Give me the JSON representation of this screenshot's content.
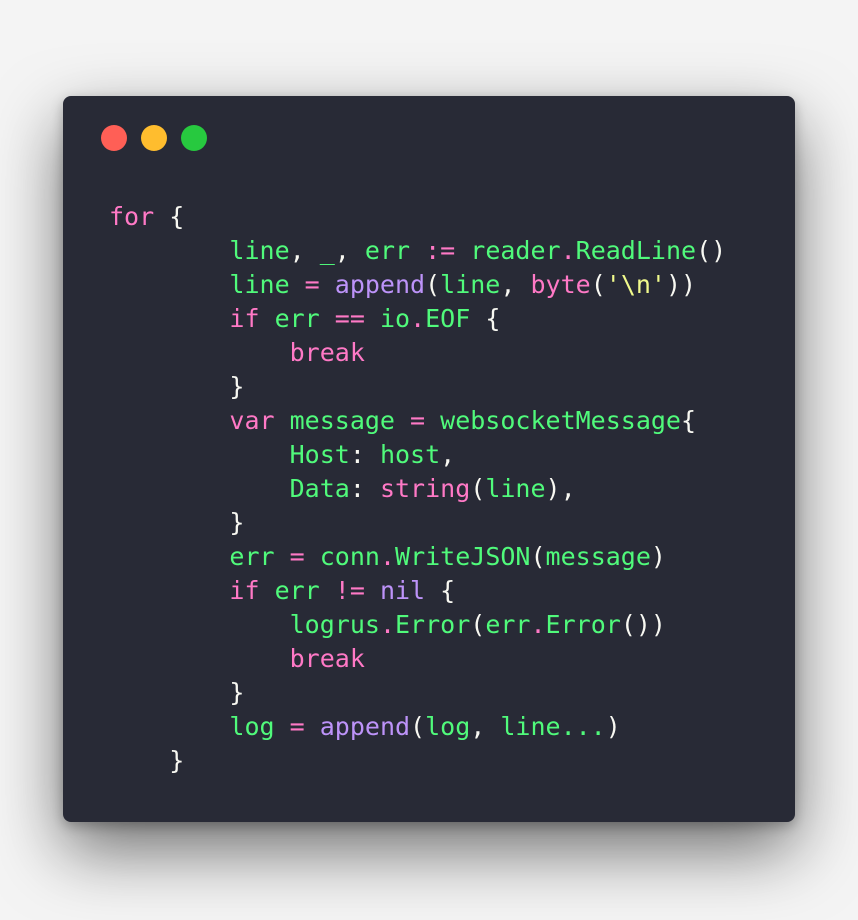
{
  "window": {
    "controls": [
      {
        "name": "close",
        "color": "#ff5f56"
      },
      {
        "name": "minimize",
        "color": "#ffbd2e"
      },
      {
        "name": "maximize",
        "color": "#27c93f"
      }
    ]
  },
  "theme": {
    "background": "#282a36",
    "keyword": "#ff79c6",
    "identifier": "#50fa7b",
    "builtin": "#bd93f9",
    "string": "#f1fa8c",
    "punctuation": "#f8f8f2"
  },
  "code": {
    "lines": [
      [
        {
          "t": "for",
          "c": "kw"
        },
        {
          "t": " {",
          "c": "pn"
        }
      ],
      [
        {
          "t": "        line",
          "c": "id"
        },
        {
          "t": ", ",
          "c": "pn"
        },
        {
          "t": "_",
          "c": "id"
        },
        {
          "t": ", ",
          "c": "pn"
        },
        {
          "t": "err",
          "c": "id"
        },
        {
          "t": " := ",
          "c": "op"
        },
        {
          "t": "reader",
          "c": "id"
        },
        {
          "t": ".",
          "c": "op"
        },
        {
          "t": "ReadLine",
          "c": "id"
        },
        {
          "t": "()",
          "c": "pn"
        }
      ],
      [
        {
          "t": "        line",
          "c": "id"
        },
        {
          "t": " = ",
          "c": "op"
        },
        {
          "t": "append",
          "c": "fn"
        },
        {
          "t": "(",
          "c": "pn"
        },
        {
          "t": "line",
          "c": "id"
        },
        {
          "t": ", ",
          "c": "pn"
        },
        {
          "t": "byte",
          "c": "kw"
        },
        {
          "t": "(",
          "c": "pn"
        },
        {
          "t": "'\\n'",
          "c": "str"
        },
        {
          "t": "))",
          "c": "pn"
        }
      ],
      [
        {
          "t": "        if",
          "c": "kw"
        },
        {
          "t": " err",
          "c": "id"
        },
        {
          "t": " == ",
          "c": "op"
        },
        {
          "t": "io",
          "c": "id"
        },
        {
          "t": ".",
          "c": "op"
        },
        {
          "t": "EOF",
          "c": "id"
        },
        {
          "t": " {",
          "c": "pn"
        }
      ],
      [
        {
          "t": "            break",
          "c": "kw"
        }
      ],
      [
        {
          "t": "        }",
          "c": "pn"
        }
      ],
      [
        {
          "t": "        var",
          "c": "kw"
        },
        {
          "t": " message",
          "c": "id"
        },
        {
          "t": " = ",
          "c": "op"
        },
        {
          "t": "websocketMessage",
          "c": "id"
        },
        {
          "t": "{",
          "c": "pn"
        }
      ],
      [
        {
          "t": "            Host",
          "c": "id"
        },
        {
          "t": ": ",
          "c": "pn"
        },
        {
          "t": "host",
          "c": "id"
        },
        {
          "t": ",",
          "c": "pn"
        }
      ],
      [
        {
          "t": "            Data",
          "c": "id"
        },
        {
          "t": ": ",
          "c": "pn"
        },
        {
          "t": "string",
          "c": "kw"
        },
        {
          "t": "(",
          "c": "pn"
        },
        {
          "t": "line",
          "c": "id"
        },
        {
          "t": "),",
          "c": "pn"
        }
      ],
      [
        {
          "t": "        }",
          "c": "pn"
        }
      ],
      [
        {
          "t": "        err",
          "c": "id"
        },
        {
          "t": " = ",
          "c": "op"
        },
        {
          "t": "conn",
          "c": "id"
        },
        {
          "t": ".",
          "c": "op"
        },
        {
          "t": "WriteJSON",
          "c": "id"
        },
        {
          "t": "(",
          "c": "pn"
        },
        {
          "t": "message",
          "c": "id"
        },
        {
          "t": ")",
          "c": "pn"
        }
      ],
      [
        {
          "t": "        if",
          "c": "kw"
        },
        {
          "t": " err",
          "c": "id"
        },
        {
          "t": " != ",
          "c": "op"
        },
        {
          "t": "nil",
          "c": "fn"
        },
        {
          "t": " {",
          "c": "pn"
        }
      ],
      [
        {
          "t": "            logrus",
          "c": "id"
        },
        {
          "t": ".",
          "c": "op"
        },
        {
          "t": "Error",
          "c": "id"
        },
        {
          "t": "(",
          "c": "pn"
        },
        {
          "t": "err",
          "c": "id"
        },
        {
          "t": ".",
          "c": "op"
        },
        {
          "t": "Error",
          "c": "id"
        },
        {
          "t": "())",
          "c": "pn"
        }
      ],
      [
        {
          "t": "            break",
          "c": "kw"
        }
      ],
      [
        {
          "t": "        }",
          "c": "pn"
        }
      ],
      [
        {
          "t": "        log",
          "c": "id"
        },
        {
          "t": " = ",
          "c": "op"
        },
        {
          "t": "append",
          "c": "fn"
        },
        {
          "t": "(",
          "c": "pn"
        },
        {
          "t": "log",
          "c": "id"
        },
        {
          "t": ", ",
          "c": "pn"
        },
        {
          "t": "line...",
          "c": "id"
        },
        {
          "t": ")",
          "c": "pn"
        }
      ],
      [
        {
          "t": "    }",
          "c": "pn"
        }
      ]
    ]
  }
}
